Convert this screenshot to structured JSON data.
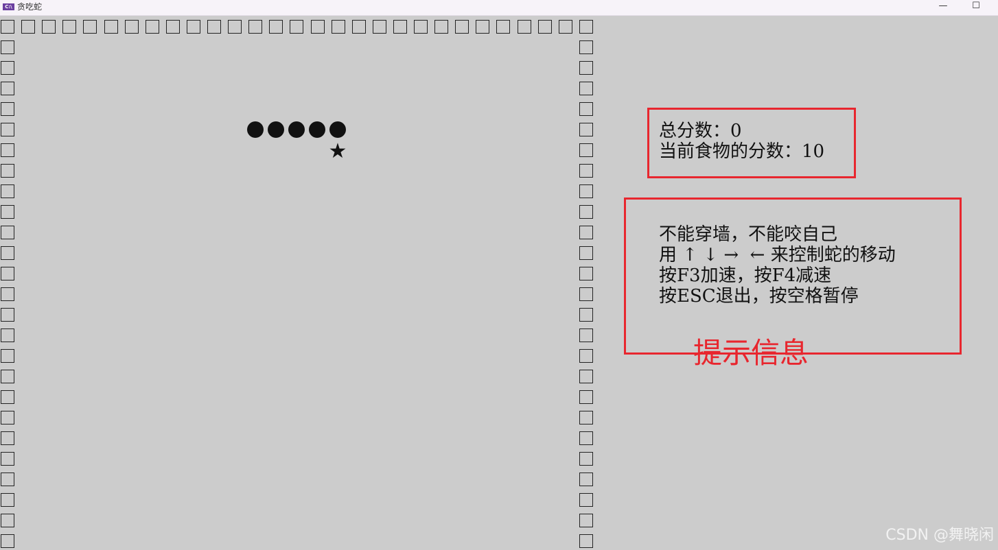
{
  "window": {
    "title": "贪吃蛇",
    "app_icon_text": "C:\\",
    "minimize_glyph": "—",
    "maximize_glyph": "☐"
  },
  "board": {
    "wall_symbol": "square-outline",
    "snake_symbol": "filled-circle",
    "food_symbol": "★",
    "snake_length": 5
  },
  "info": {
    "score_label": "总分数：0",
    "food_score_label": "当前食物的分数：10",
    "help_lines": [
      "不能穿墙，不能咬自己",
      "用 ↑ ↓ →  ← 来控制蛇的移动",
      "按F3加速，按F4减速",
      "按ESC退出，按空格暂停"
    ]
  },
  "annotations": {
    "help_caption": "提示信息",
    "box_color": "#e8262e"
  },
  "watermark": "CSDN @舞晓闲"
}
